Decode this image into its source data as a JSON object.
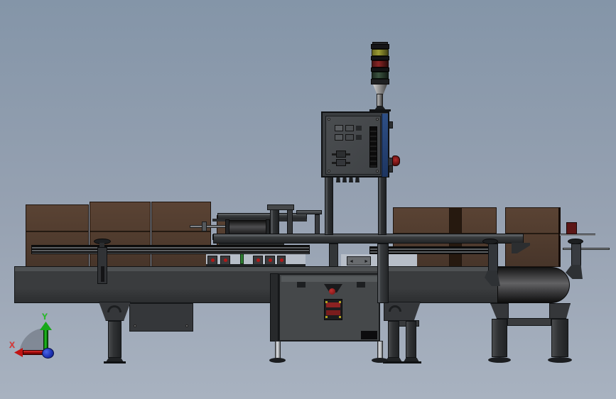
{
  "background": {
    "top_color": "#8495a8",
    "bottom_color": "#a8b2c0"
  },
  "triad": {
    "x_label": "X",
    "y_label": "Y",
    "x_color": "#e03434",
    "y_color": "#21c421",
    "z_color": "#2438c8"
  },
  "stack_light": {
    "yellow": "#9b9b33",
    "red": "#8a2525",
    "green": "#3b5340"
  },
  "palette": {
    "carton_brown": "#523d2f",
    "frame_gray": "#3a3d3f",
    "cabinet_gray": "#45484a",
    "door_blue": "#2e4f86",
    "estop_red": "#a02020",
    "sensor_red": "#b01818"
  },
  "sensor_box": {
    "left_arrow": "◄",
    "right_arrow": "►"
  }
}
